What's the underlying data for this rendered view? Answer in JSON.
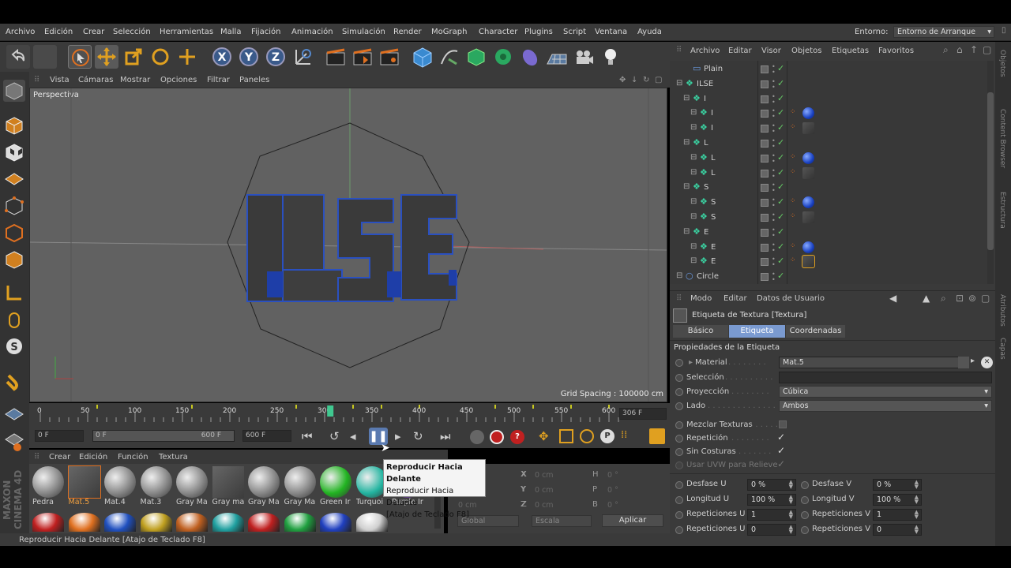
{
  "menu": [
    "Archivo",
    "Edición",
    "Crear",
    "Selección",
    "Herramientas",
    "Malla",
    "Fijación",
    "Animación",
    "Simulación",
    "Render",
    "MoGraph",
    "Character",
    "Plugins",
    "Script",
    "Ventana",
    "Ayuda"
  ],
  "environment": {
    "label": "Entorno:",
    "value": "Entorno de Arranque"
  },
  "viewport_menu": [
    "Vista",
    "Cámaras",
    "Mostrar",
    "Opciones",
    "Filtrar",
    "Paneles"
  ],
  "viewport": {
    "label": "Perspectiva",
    "grid_spacing": "Grid Spacing : 100000 cm",
    "text3d": "ILSE"
  },
  "timeline": {
    "ticks": [
      "0",
      "50",
      "100",
      "150",
      "200",
      "250",
      "300",
      "350",
      "400",
      "450",
      "500",
      "550",
      "600"
    ],
    "current_frame": "306 F",
    "playhead_frame": 306
  },
  "controls": {
    "start_field": "0 F",
    "range_start": "0 F",
    "range_end": "600 F",
    "end_field": "600 F"
  },
  "material_menu": [
    "Crear",
    "Edición",
    "Función",
    "Textura"
  ],
  "materials_row1": [
    {
      "name": "Pedra",
      "color": "#888888",
      "selected": false
    },
    {
      "name": "Mat.5",
      "color": "#3c3c3c",
      "selected": true
    },
    {
      "name": "Mat.4",
      "color": "#888888",
      "selected": false
    },
    {
      "name": "Mat.3",
      "color": "#888888",
      "selected": false
    },
    {
      "name": "Gray Ma",
      "color": "#888888",
      "selected": false
    },
    {
      "name": "Gray ma",
      "color": "#3c3c3c",
      "selected": false
    },
    {
      "name": "Gray Ma",
      "color": "#888888",
      "selected": false
    },
    {
      "name": "Gray Ma",
      "color": "#888888",
      "selected": false
    },
    {
      "name": "Green Ir",
      "color": "#22b422",
      "selected": false
    },
    {
      "name": "Turquoi",
      "color": "#22b4a0",
      "selected": false
    },
    {
      "name": "Purple Ir",
      "color": "#8040c0",
      "selected": false
    }
  ],
  "materials_row2_colors": [
    "#c02020",
    "#e07020",
    "#2050c0",
    "#c0a020",
    "#c06020",
    "#20a0a0",
    "#c02020",
    "#20a040",
    "#2040c0",
    "#d0d0d0"
  ],
  "coords": {
    "rows": [
      [
        "X",
        "0 cm",
        "X",
        "0 cm",
        "H",
        "0 °"
      ],
      [
        "Y",
        "0 cm",
        "Y",
        "0 cm",
        "P",
        "0 °"
      ],
      [
        "Z",
        "0 cm",
        "Z",
        "0 cm",
        "B",
        "0 °"
      ]
    ],
    "mode1": "Global",
    "mode2": "Escala",
    "apply": "Aplicar"
  },
  "tooltip": {
    "title": "Reproducir Hacia Delante",
    "line2": "Reproducir Hacia Delante",
    "line3": "[Atajo de Teclado F8]"
  },
  "status": "Reproducir Hacia Delante [Atajo de Teclado F8]",
  "objects_menu": [
    "Archivo",
    "Editar",
    "Visor",
    "Objetos",
    "Etiquetas",
    "Favoritos"
  ],
  "objects": [
    {
      "name": "Plain",
      "indent": 1,
      "tags": []
    },
    {
      "name": "ILSE",
      "indent": 0,
      "tags": []
    },
    {
      "name": "I",
      "indent": 1,
      "tags": []
    },
    {
      "name": "I",
      "indent": 2,
      "tags": [
        "blue"
      ]
    },
    {
      "name": "I",
      "indent": 2,
      "tags": [
        "dark"
      ]
    },
    {
      "name": "L",
      "indent": 1,
      "tags": []
    },
    {
      "name": "L",
      "indent": 2,
      "tags": [
        "blue"
      ]
    },
    {
      "name": "L",
      "indent": 2,
      "tags": [
        "dark"
      ]
    },
    {
      "name": "S",
      "indent": 1,
      "tags": []
    },
    {
      "name": "S",
      "indent": 2,
      "tags": [
        "blue"
      ]
    },
    {
      "name": "S",
      "indent": 2,
      "tags": [
        "dark"
      ]
    },
    {
      "name": "E",
      "indent": 1,
      "tags": []
    },
    {
      "name": "E",
      "indent": 2,
      "tags": [
        "blue"
      ]
    },
    {
      "name": "E",
      "indent": 2,
      "tags": [
        "dark-selected"
      ]
    },
    {
      "name": "Circle",
      "indent": 0,
      "tags": []
    }
  ],
  "attr_menu": [
    "Modo",
    "Editar",
    "Datos de Usuario"
  ],
  "attr_title": "Etiqueta de Textura [Textura]",
  "attr_tabs": [
    "Básico",
    "Etiqueta",
    "Coordenadas"
  ],
  "attr_active_tab": 1,
  "attr_section": "Propiedades de la Etiqueta",
  "attr": {
    "material_label": "Material",
    "material_value": "Mat.5",
    "seleccion_label": "Selección",
    "proyeccion_label": "Proyección",
    "proyeccion_value": "Cúbica",
    "lado_label": "Lado",
    "lado_value": "Ambos",
    "mezclar_label": "Mezclar Texturas",
    "repeticion_label": "Repetición",
    "sincosturas_label": "Sin Costuras",
    "uvw_label": "Usar UVW para Relieve",
    "desfase_u_label": "Desfase U",
    "desfase_u": "0 %",
    "desfase_v_label": "Desfase V",
    "desfase_v": "0 %",
    "long_u_label": "Longitud U",
    "long_u": "100 %",
    "long_v_label": "Longitud V",
    "long_v": "100 %",
    "rep_u_label": "Repeticiones U",
    "rep_u": "1",
    "rep_v_label": "Repeticiones V",
    "rep_v": "1",
    "rep_u2_label": "Repeticiones U",
    "rep_u2": "0",
    "rep_v2_label": "Repeticiones V",
    "rep_v2": "0"
  },
  "right_side_tabs": [
    "Objetos",
    "Content Browser",
    "Estructura",
    "Atributos",
    "Capas"
  ],
  "brand": "MAXON CINEMA 4D"
}
